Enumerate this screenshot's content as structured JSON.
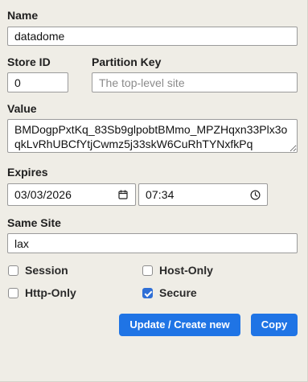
{
  "form": {
    "name": {
      "label": "Name",
      "value": "datadome"
    },
    "store_id": {
      "label": "Store ID",
      "value": "0"
    },
    "partition_key": {
      "label": "Partition Key",
      "placeholder": "The top-level site",
      "value": ""
    },
    "value": {
      "label": "Value",
      "text": "BMDogpPxtKq_83Sb9glpobtBMmo_MPZHqxn33Plx3oqkLvRhUBCfYtjCwmz5j33skW6CuRhTYNxfkPq"
    },
    "expires": {
      "label": "Expires",
      "date": "03/03/2026",
      "time": "07:34"
    },
    "same_site": {
      "label": "Same Site",
      "selected": "lax"
    },
    "checkboxes": {
      "session": {
        "label": "Session",
        "checked": false
      },
      "host_only": {
        "label": "Host-Only",
        "checked": false
      },
      "http_only": {
        "label": "Http-Only",
        "checked": false
      },
      "secure": {
        "label": "Secure",
        "checked": true
      }
    },
    "buttons": {
      "update_create": "Update / Create new",
      "copy": "Copy"
    }
  },
  "icons": {
    "date_picker": "calendar-icon",
    "time_picker": "clock-icon"
  },
  "colors": {
    "background": "#efede6",
    "accent": "#1f74e5",
    "checkbox_checked": "#2f6fd6",
    "field_border": "#9b9b9b"
  }
}
